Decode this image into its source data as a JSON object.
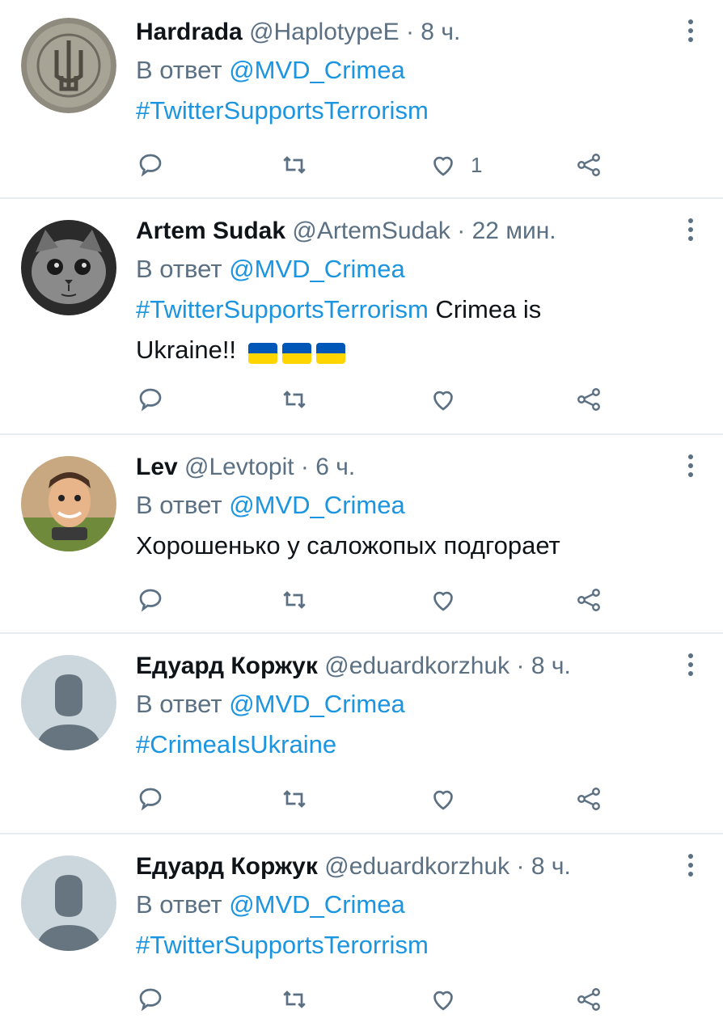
{
  "tweets": [
    {
      "name": "Hardrada",
      "handle": "@HaplotypeE",
      "time": "8 ч.",
      "reply_prefix": "В ответ",
      "reply_to": "@MVD_Crimea",
      "hashtag": "#TwitterSupportsTerrorism",
      "text": "",
      "like_count": "1",
      "avatar": "coin-trident-avatar"
    },
    {
      "name": "Artem Sudak",
      "handle": "@ArtemSudak",
      "time": "22 мин.",
      "reply_prefix": "В ответ",
      "reply_to": "@MVD_Crimea",
      "hashtag": "#TwitterSupportsTerrorism",
      "text": "Crimea is",
      "text2": "Ukraine!!",
      "flag_count": 3,
      "like_count": "",
      "avatar": "cat-avatar"
    },
    {
      "name": "Lev",
      "handle": "@Levtopit",
      "time": "6 ч.",
      "reply_prefix": "В ответ",
      "reply_to": "@MVD_Crimea",
      "hashtag": "",
      "text": "Хорошенько у саложопых подгорает",
      "like_count": "",
      "avatar": "person-photo-avatar"
    },
    {
      "name": "Едуард Коржук",
      "handle": "@eduardkorzhuk",
      "time": "8 ч.",
      "reply_prefix": "В ответ",
      "reply_to": "@MVD_Crimea",
      "hashtag": "#CrimeaIsUkraine",
      "text": "",
      "like_count": "",
      "avatar": "default-avatar"
    },
    {
      "name": "Едуард Коржук",
      "handle": "@eduardkorzhuk",
      "time": "8 ч.",
      "reply_prefix": "В ответ",
      "reply_to": "@MVD_Crimea",
      "hashtag": "#TwitterSupportsTerorrism",
      "text": "",
      "like_count": "",
      "avatar": "default-avatar"
    }
  ],
  "colors": {
    "link": "#1b95e0",
    "muted": "#5b7083",
    "text": "#0f1419",
    "divider": "#e6ecf0"
  },
  "icons": [
    "reply-icon",
    "retweet-icon",
    "like-icon",
    "share-icon",
    "more-icon"
  ]
}
